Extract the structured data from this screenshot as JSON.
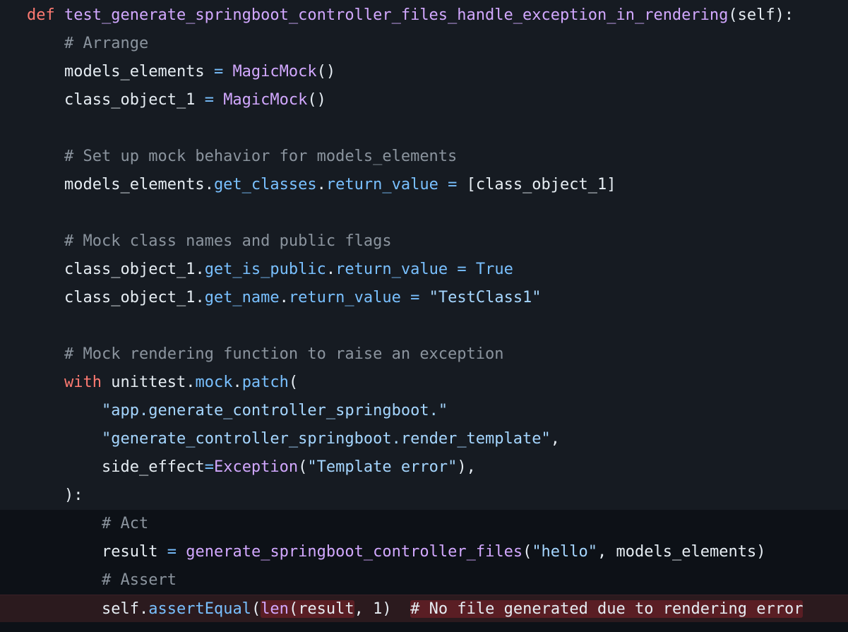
{
  "code": {
    "l1": {
      "kw": "def",
      "fn": "test_generate_springboot_controller_files_handle_exception_in_rendering",
      "rest": "(self):"
    },
    "l2": {
      "comment": "# Arrange"
    },
    "l3": {
      "var": "models_elements",
      "op": "=",
      "call": "MagicMock",
      "rest": "()"
    },
    "l4": {
      "var": "class_object_1",
      "op": "=",
      "call": "MagicMock",
      "rest": "()"
    },
    "l6": {
      "comment": "# Set up mock behavior for models_elements"
    },
    "l7": {
      "obj": "models_elements",
      "p1": "get_classes",
      "p2": "return_value",
      "op": "=",
      "rest": "[class_object_1]"
    },
    "l9": {
      "comment": "# Mock class names and public flags"
    },
    "l10": {
      "obj": "class_object_1",
      "p1": "get_is_public",
      "p2": "return_value",
      "op": "=",
      "val": "True"
    },
    "l11": {
      "obj": "class_object_1",
      "p1": "get_name",
      "p2": "return_value",
      "op": "=",
      "val": "\"TestClass1\""
    },
    "l13": {
      "comment": "# Mock rendering function to raise an exception"
    },
    "l14": {
      "kw": "with",
      "obj": "unittest",
      "p1": "mock",
      "p2": "patch",
      "rest": "("
    },
    "l15": {
      "str": "\"app.generate_controller_springboot.\""
    },
    "l16": {
      "str": "\"generate_controller_springboot.render_template\"",
      "rest": ","
    },
    "l17": {
      "arg": "side_effect",
      "op": "=",
      "call": "Exception",
      "str": "\"Template error\"",
      "rest": "),"
    },
    "l18": {
      "text": "):"
    },
    "l19": {
      "comment": "# Act"
    },
    "l20": {
      "var": "result",
      "op": "=",
      "call": "generate_springboot_controller_files",
      "str": "\"hello\"",
      "rest": ", models_elements)"
    },
    "l21": {
      "comment": "# Assert"
    },
    "l22": {
      "obj": "self",
      "p1": "assertEqual",
      "call": "len",
      "arg": "result",
      "rest": ", 1)",
      "comment": "# No file generated due to rendering error"
    }
  }
}
